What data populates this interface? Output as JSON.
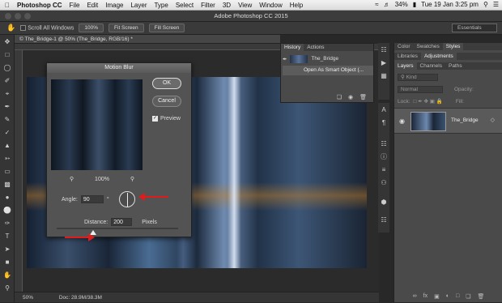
{
  "menubar": {
    "apple": "",
    "app": "Photoshop CC",
    "items": [
      "File",
      "Edit",
      "Image",
      "Layer",
      "Type",
      "Select",
      "Filter",
      "3D",
      "View",
      "Window",
      "Help"
    ],
    "battery": "34%",
    "datetime": "Tue 19 Jan  3:25 pm"
  },
  "window": {
    "title": "Adobe Photoshop CC 2015"
  },
  "options": {
    "scroll_all": "Scroll All Windows",
    "zoom": "100%",
    "fit1": "Fit Screen",
    "fit2": "Fill Screen",
    "workspace": "Essentials"
  },
  "doc": {
    "tab": "© The_Bridge-1 @ 50% (The_Bridge, RGB/16) *",
    "zoom": "50%",
    "docsize": "Doc: 28.9M/38.3M"
  },
  "dialog": {
    "title": "Motion Blur",
    "ok": "OK",
    "cancel": "Cancel",
    "preview": "Preview",
    "zoom": "100%",
    "angle_label": "Angle:",
    "angle_value": "90",
    "degree": "°",
    "distance_label": "Distance:",
    "distance_value": "200",
    "unit": "Pixels",
    "slider_fraction": 0.3
  },
  "history": {
    "tabs": [
      "History",
      "Actions"
    ],
    "snapshot": "The_Bridge",
    "state": "Open As Smart Object (..."
  },
  "panels": {
    "top_tabs": [
      "Color",
      "Swatches",
      "Styles"
    ],
    "mid_tabs": [
      "Libraries",
      "Adjustments"
    ],
    "layer_tabs": [
      "Layers",
      "Channels",
      "Paths"
    ],
    "kind": "Kind",
    "blend": "Normal",
    "opacity_label": "Opacity:",
    "lock_label": "Lock:",
    "fill_label": "Fill:",
    "layer_name": "The_Bridge"
  },
  "icons": {
    "tools": [
      "move",
      "marquee",
      "lasso",
      "quick-select",
      "crop",
      "eyedropper",
      "healing",
      "brush",
      "stamp",
      "history-brush",
      "eraser",
      "gradient",
      "blur",
      "dodge",
      "pen",
      "type",
      "path-select",
      "shape",
      "hand",
      "zoom"
    ]
  }
}
